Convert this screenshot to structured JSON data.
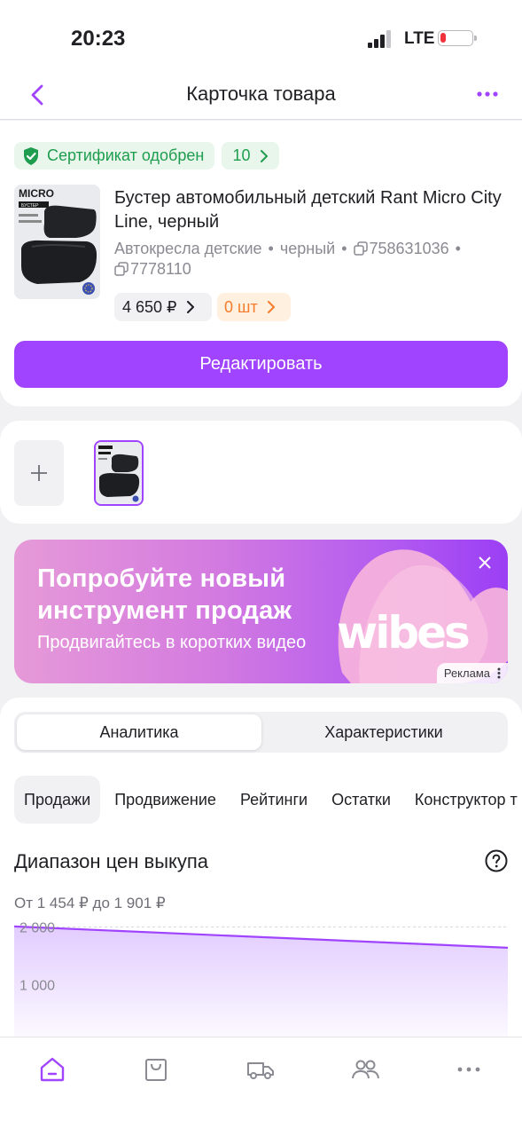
{
  "status_bar": {
    "time": "20:23",
    "network": "LTE"
  },
  "header": {
    "title": "Карточка товара",
    "back_icon": "chevron-left-icon",
    "more_icon": "more-dots-icon"
  },
  "product": {
    "certificate": "Сертификат одобрен",
    "count": "10",
    "name": "Бустер автомобильный детский Rant Micro City Line, черный",
    "category": "Автокресла детские",
    "color": "черный",
    "id1": "758631036",
    "id2": "7778110",
    "price": "4 650 ₽",
    "stock": "0 шт",
    "edit_label": "Редактировать",
    "thumb_text": {
      "brand": "MICRO",
      "tag": "БУСТЕР"
    }
  },
  "photos": {
    "add_icon": "plus-icon"
  },
  "banner": {
    "headline_line1": "Попробуйте новый",
    "headline_line2": "инструмент продаж",
    "subtitle": "Продвигайтесь в коротких видео",
    "brand": "wibes",
    "ad_label": "Реклама"
  },
  "analytics": {
    "segments": [
      "Аналитика",
      "Характеристики"
    ],
    "tabs": [
      "Продажи",
      "Продвижение",
      "Рейтинги",
      "Остатки",
      "Конструктор т"
    ],
    "section_title": "Диапазон цен выкупа",
    "range_text": "От 1 454 ₽ до 1 901 ₽"
  },
  "chart_data": {
    "type": "area",
    "y_ticks": [
      "2 000",
      "1 000"
    ],
    "y_tick_values": [
      2000,
      1000
    ],
    "series": [
      {
        "values": [
          2010,
          1640
        ]
      }
    ],
    "ylim": [
      0,
      2100
    ],
    "colors": {
      "line": "#a044ff"
    }
  },
  "tabbar": {
    "items": [
      "home-icon",
      "bag-icon",
      "truck-icon",
      "users-icon",
      "more-icon"
    ]
  },
  "colors": {
    "accent": "#a044ff",
    "green": "#1f9d4e",
    "orange": "#f57c2a"
  }
}
